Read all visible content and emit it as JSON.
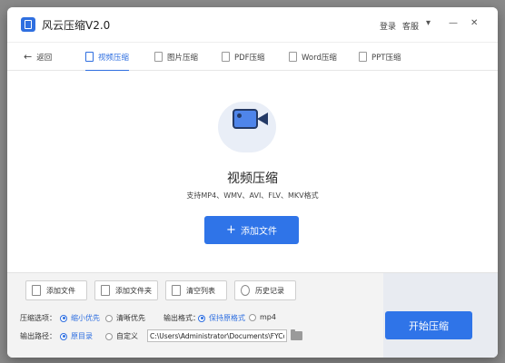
{
  "app": {
    "title": "风云压缩V2.0"
  },
  "titlebar": {
    "login": "登录",
    "service": "客服",
    "icons": [
      "chevron-down-icon",
      "minimize-icon",
      "close-icon"
    ]
  },
  "tabs": {
    "back": "返回",
    "items": [
      {
        "label": "视频压缩",
        "active": true
      },
      {
        "label": "图片压缩"
      },
      {
        "label": "PDF压缩"
      },
      {
        "label": "Word压缩"
      },
      {
        "label": "PPT压缩"
      }
    ]
  },
  "main": {
    "title": "视频压缩",
    "subtitle": "支持MP4、WMV、AVI、FLV、MKV格式",
    "add_button": "添加文件",
    "icon": "video-camera-icon"
  },
  "toolbar": {
    "add_file": "添加文件",
    "add_folder": "添加文件夹",
    "clear_list": "清空列表",
    "history": "历史记录"
  },
  "options": {
    "compress_label": "压缩选项：",
    "compress_opt1": "缩小优先",
    "compress_opt2": "清晰优先",
    "format_label": "输出格式：",
    "format_opt1": "保持原格式",
    "format_opt2": "mp4",
    "path_label": "输出路径：",
    "path_opt1": "原目录",
    "path_opt2": "自定义",
    "path_value": "C:\\Users\\Administrator\\Documents\\FYCom"
  },
  "start_button": "开始压缩",
  "colors": {
    "accent": "#2f74e8",
    "active_tab": "#2f6fe0"
  }
}
